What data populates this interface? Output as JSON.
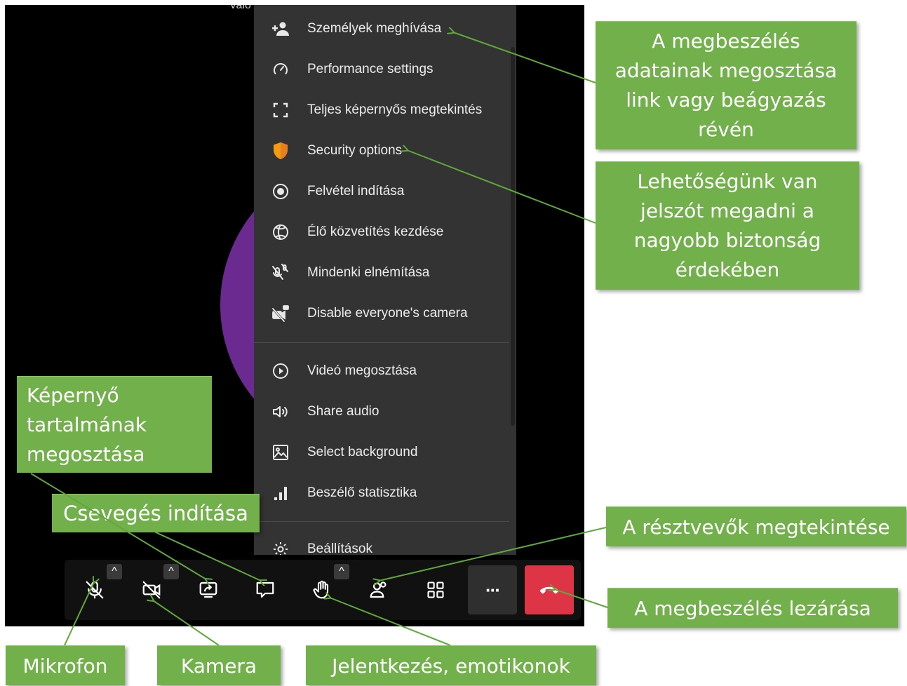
{
  "stage": {
    "participant_name_fragment": "Valo",
    "avatar_color": "#6b2a8f"
  },
  "menu": {
    "items": [
      {
        "label": "Személyek meghívása",
        "icon": "add-person-icon"
      },
      {
        "label": "Performance settings",
        "icon": "gauge-icon"
      },
      {
        "label": "Teljes képernyős megtekintés",
        "icon": "fullscreen-icon"
      },
      {
        "label": "Security options",
        "icon": "shield-icon",
        "icon_color": "#f39c12"
      },
      {
        "label": "Felvétel indítása",
        "icon": "record-icon"
      },
      {
        "label": "Élő közvetítés kezdése",
        "icon": "live-stream-icon"
      },
      {
        "label": "Mindenki elnémítása",
        "icon": "mute-everyone-icon"
      },
      {
        "label": "Disable everyone's camera",
        "icon": "camera-off-everyone-icon"
      },
      {
        "label": "Videó megosztása",
        "icon": "play-icon"
      },
      {
        "label": "Share audio",
        "icon": "speaker-icon"
      },
      {
        "label": "Select background",
        "icon": "image-icon"
      },
      {
        "label": "Beszélő statisztika",
        "icon": "stats-icon"
      },
      {
        "label": "Beállítások",
        "icon": "gear-icon"
      }
    ]
  },
  "toolbar": {
    "buttons": [
      {
        "name": "microphone",
        "icon": "mic-off-icon",
        "has_caret": true
      },
      {
        "name": "camera",
        "icon": "camera-off-icon",
        "has_caret": true
      },
      {
        "name": "screen-share",
        "icon": "screen-share-icon",
        "has_caret": false
      },
      {
        "name": "chat",
        "icon": "chat-icon",
        "has_caret": false
      },
      {
        "name": "raise-hand",
        "icon": "hand-icon",
        "has_caret": true
      },
      {
        "name": "participants",
        "icon": "participants-icon",
        "has_caret": false
      },
      {
        "name": "tile-view",
        "icon": "grid-icon",
        "has_caret": false
      },
      {
        "name": "more",
        "icon": "ellipsis-icon",
        "label": "···"
      },
      {
        "name": "hangup",
        "icon": "hangup-icon",
        "color": "#dd3545"
      }
    ],
    "caret_glyph": "^"
  },
  "callouts": {
    "share_info": "A megbeszélés\nadatainak megosztása\nlink vagy beágyazás\nrévén",
    "password": "Lehetőségünk van\njelszót megadni a\nnagyobb biztonság\nérdekében",
    "screen_share": "Képernyő\ntartalmának\nmegosztása",
    "chat": "Csevegés indítása",
    "participants": "A résztvevők megtekintése",
    "hangup": "A megbeszélés lezárása",
    "microphone": "Mikrofon",
    "camera": "Kamera",
    "reactions": "Jelentkezés, emotikonok"
  },
  "colors": {
    "callout_green": "#71b04a",
    "arrow_green": "#5fa83a",
    "menu_bg": "#333333",
    "hangup_red": "#dd3545"
  }
}
